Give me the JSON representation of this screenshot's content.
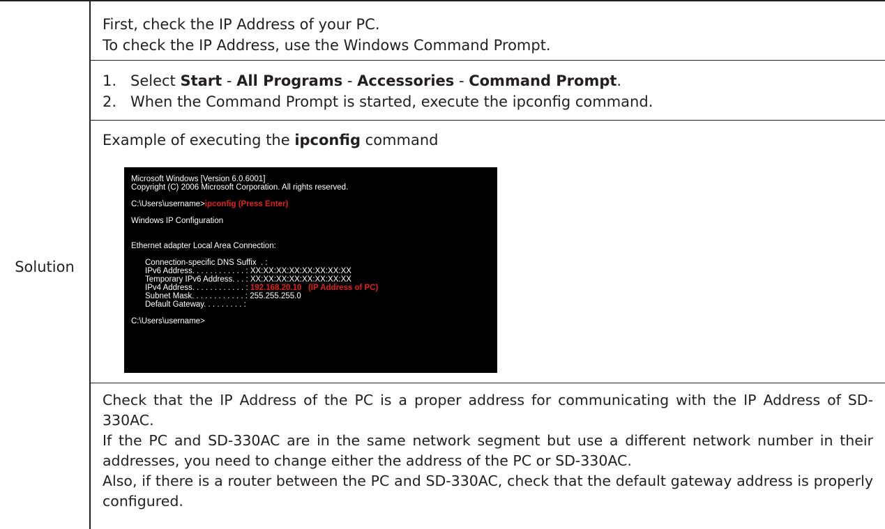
{
  "row_label": "Solution",
  "intro": {
    "line1": "First, check the IP Address of your PC.",
    "line2": "To check the IP Address, use the Windows Command Prompt."
  },
  "steps": [
    {
      "num": "1.",
      "prefix": "Select ",
      "menu": [
        "Start",
        "All Programs",
        "Accessories",
        "Command Prompt"
      ],
      "sep": " - ",
      "suffix": "."
    },
    {
      "num": "2.",
      "text": "When the Command Prompt is started, execute the ipconfig command."
    }
  ],
  "example": {
    "prefix": "Example of executing the ",
    "bold": "ipconfig",
    "suffix": " command"
  },
  "terminal": {
    "l1": "Microsoft Windows [Version 6.0.6001]",
    "l2": "Copyright (C) 2006 Microsoft Corporation. All rights reserved.",
    "l3_prompt": "C:\\Users\\username>",
    "l3_cmd": "ipconfig (Press Enter)",
    "l4": "Windows IP Configuration",
    "l5": "Ethernet adapter Local Area Connection:",
    "l6": "Connection-specific DNS Suffix  . :",
    "l7": "IPv6 Address. . . . . . . . . . . . : XX:XX:XX:XX:XX:XX:XX:XX",
    "l8": "Temporary IPv6 Address. . . : XX:XX:XX:XX:XX:XX:XX:XX",
    "l9_label": "IPv4 Address. . . . . . . . . . . . : ",
    "l9_value": "192.168.20.10   (IP Address of PC)",
    "l10": "Subnet Mask. . . . . . . . . . . . : 255.255.255.0",
    "l11": "Default Gateway. . . . . . . . . :",
    "l12": "C:\\Users\\username>"
  },
  "paragraphs": {
    "p1": "Check that the IP Address of the PC is a proper address for communicating with the IP Address of SD-330AC.",
    "p2": "If the PC and SD-330AC are in the same network segment but use a different network number in their addresses, you need to change either the address of the PC or SD-330AC.",
    "p3": "Also, if there is a router between the PC and SD-330AC, check that the default gateway address is properly configured."
  }
}
